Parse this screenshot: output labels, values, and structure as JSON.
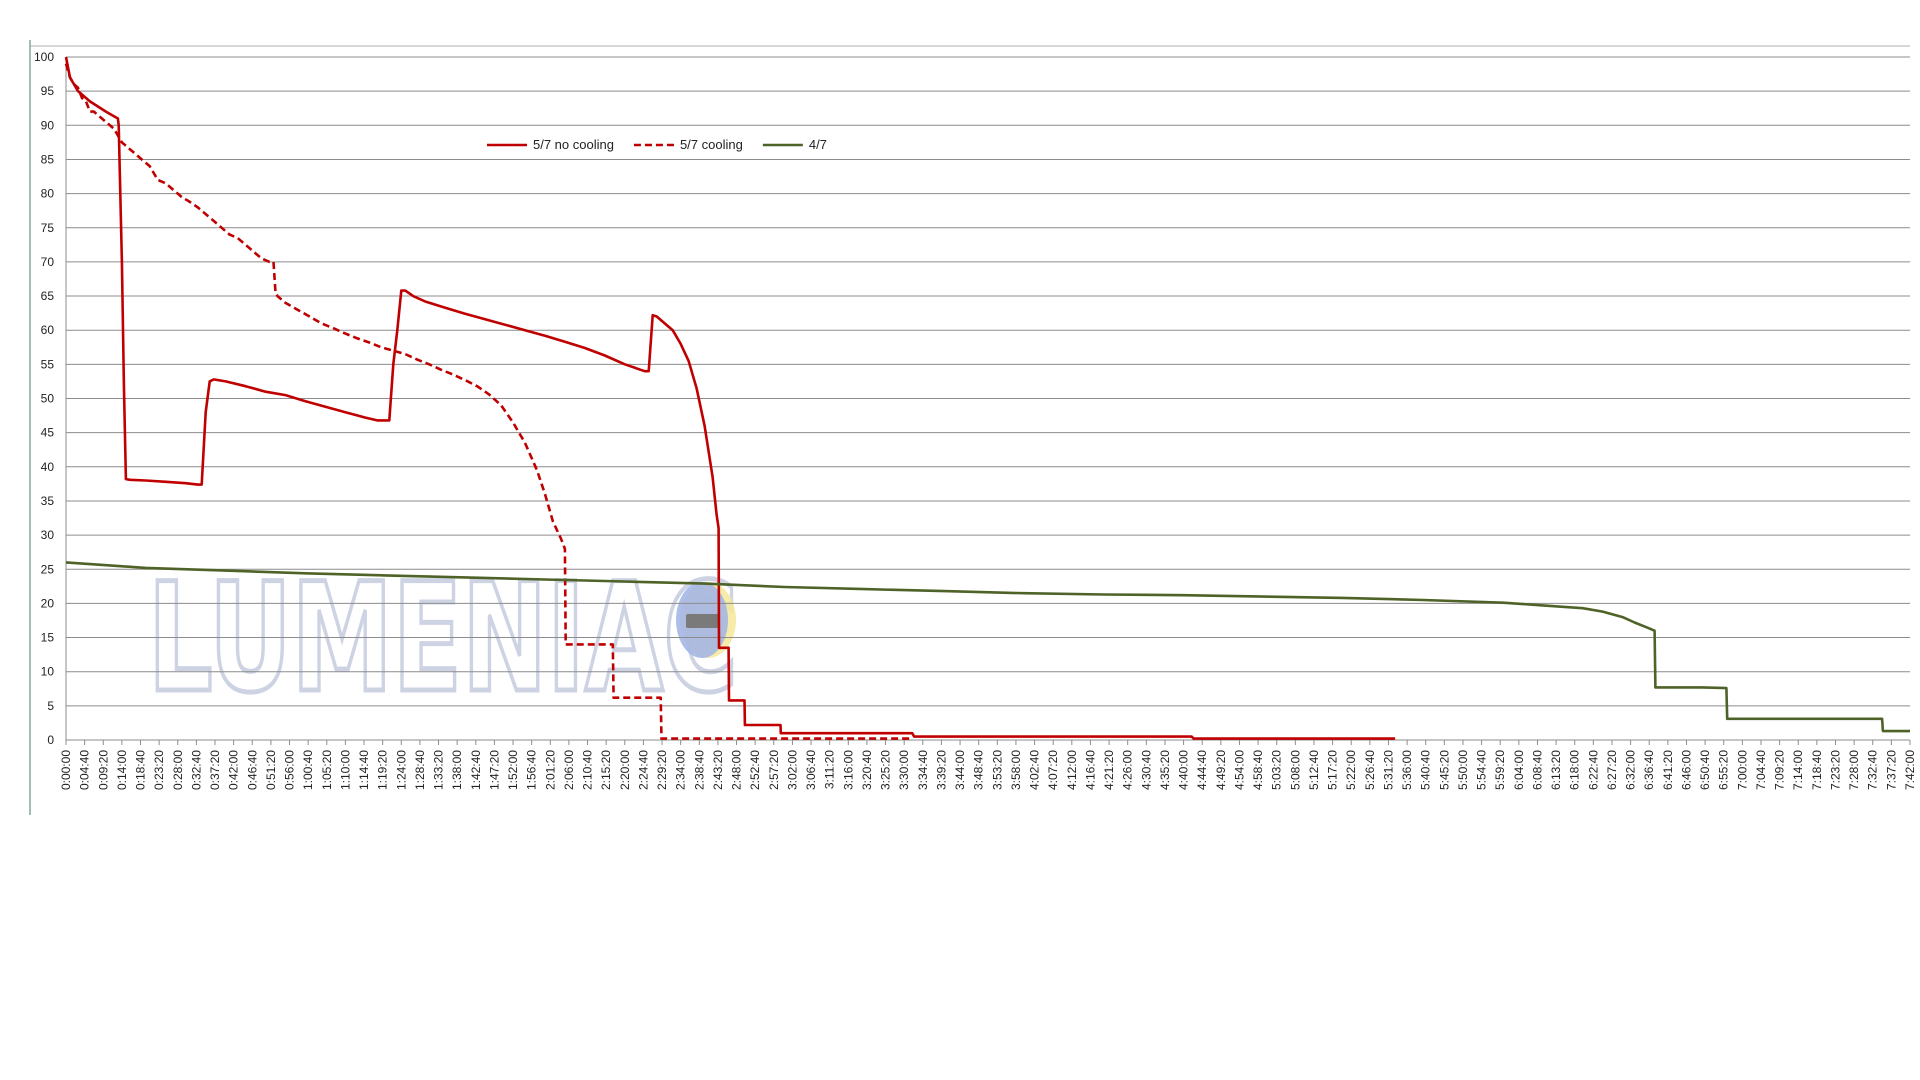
{
  "chart_data": {
    "type": "line",
    "title": "",
    "xlabel": "",
    "ylabel": "",
    "ylim": [
      0,
      100
    ],
    "yticks": [
      0,
      5,
      10,
      15,
      20,
      25,
      30,
      35,
      40,
      45,
      50,
      55,
      60,
      65,
      70,
      75,
      80,
      85,
      90,
      95,
      100
    ],
    "xlim_minutes": [
      0,
      462
    ],
    "grid": "horizontal",
    "legend_position": "top-center",
    "watermark": "LUMENIAC",
    "x_tick_labels": [
      "0:00:00",
      "0:04:40",
      "0:09:20",
      "0:14:00",
      "0:18:40",
      "0:23:20",
      "0:28:00",
      "0:32:40",
      "0:37:20",
      "0:42:00",
      "0:46:40",
      "0:51:20",
      "0:56:00",
      "1:00:40",
      "1:05:20",
      "1:10:00",
      "1:14:40",
      "1:19:20",
      "1:24:00",
      "1:28:40",
      "1:33:20",
      "1:38:00",
      "1:42:40",
      "1:47:20",
      "1:52:00",
      "1:56:40",
      "2:01:20",
      "2:06:00",
      "2:10:40",
      "2:15:20",
      "2:20:00",
      "2:24:40",
      "2:29:20",
      "2:34:00",
      "2:38:40",
      "2:43:20",
      "2:48:00",
      "2:52:40",
      "2:57:20",
      "3:02:00",
      "3:06:40",
      "3:11:20",
      "3:16:00",
      "3:20:40",
      "3:25:20",
      "3:30:00",
      "3:34:40",
      "3:39:20",
      "3:44:00",
      "3:48:40",
      "3:53:20",
      "3:58:00",
      "4:02:40",
      "4:07:20",
      "4:12:00",
      "4:16:40",
      "4:21:20",
      "4:26:00",
      "4:30:40",
      "4:35:20",
      "4:40:00",
      "4:44:40",
      "4:49:20",
      "4:54:00",
      "4:58:40",
      "5:03:20",
      "5:08:00",
      "5:12:40",
      "5:17:20",
      "5:22:00",
      "5:26:40",
      "5:31:20",
      "5:36:00",
      "5:40:40",
      "5:45:20",
      "5:50:00",
      "5:54:40",
      "5:59:20",
      "6:04:00",
      "6:08:40",
      "6:13:20",
      "6:18:00",
      "6:22:40",
      "6:27:20",
      "6:32:00",
      "6:36:40",
      "6:41:20",
      "6:46:00",
      "6:50:40",
      "6:55:20",
      "7:00:00",
      "7:04:40",
      "7:09:20",
      "7:14:00",
      "7:18:40",
      "7:23:20",
      "7:28:00",
      "7:32:40",
      "7:37:20",
      "7:42:00"
    ],
    "series": [
      {
        "name": "5/7 no cooling",
        "color": "#c00000",
        "dash": "solid",
        "points": [
          [
            0,
            100
          ],
          [
            1,
            97
          ],
          [
            3,
            95
          ],
          [
            6,
            93.5
          ],
          [
            10,
            92
          ],
          [
            13,
            91
          ],
          [
            13.2,
            90
          ],
          [
            14,
            70
          ],
          [
            14.5,
            52
          ],
          [
            15,
            38.2
          ],
          [
            16,
            38.1
          ],
          [
            20,
            38
          ],
          [
            25,
            37.8
          ],
          [
            30,
            37.6
          ],
          [
            33,
            37.4
          ],
          [
            34,
            37.4
          ],
          [
            35,
            48
          ],
          [
            36,
            52.5
          ],
          [
            37,
            52.8
          ],
          [
            40,
            52.5
          ],
          [
            45,
            51.8
          ],
          [
            50,
            51
          ],
          [
            55,
            50.5
          ],
          [
            60,
            49.6
          ],
          [
            65,
            48.8
          ],
          [
            70,
            48
          ],
          [
            75,
            47.2
          ],
          [
            78,
            46.8
          ],
          [
            81,
            46.8
          ],
          [
            82,
            55
          ],
          [
            83,
            60
          ],
          [
            84,
            65.8
          ],
          [
            85,
            65.8
          ],
          [
            87,
            65
          ],
          [
            90,
            64.2
          ],
          [
            95,
            63.3
          ],
          [
            100,
            62.4
          ],
          [
            105,
            61.6
          ],
          [
            110,
            60.8
          ],
          [
            115,
            60
          ],
          [
            120,
            59.2
          ],
          [
            125,
            58.3
          ],
          [
            130,
            57.4
          ],
          [
            135,
            56.3
          ],
          [
            140,
            55
          ],
          [
            145,
            54
          ],
          [
            146,
            54
          ],
          [
            147,
            62.2
          ],
          [
            148,
            62
          ],
          [
            150,
            61
          ],
          [
            152,
            60
          ],
          [
            154,
            58
          ],
          [
            156,
            55.5
          ],
          [
            158,
            51.5
          ],
          [
            160,
            46
          ],
          [
            162,
            38.5
          ],
          [
            163,
            33
          ],
          [
            163.5,
            31
          ],
          [
            163.6,
            13.5
          ],
          [
            165,
            13.5
          ],
          [
            166,
            13.5
          ],
          [
            166.1,
            5.8
          ],
          [
            168,
            5.8
          ],
          [
            170,
            5.8
          ],
          [
            170.1,
            2.2
          ],
          [
            175,
            2.2
          ],
          [
            179,
            2.2
          ],
          [
            179.1,
            1
          ],
          [
            185,
            1
          ],
          [
            195,
            1
          ],
          [
            205,
            1
          ],
          [
            212,
            1
          ],
          [
            212.5,
            0.5
          ],
          [
            240,
            0.5
          ],
          [
            265,
            0.5
          ],
          [
            282,
            0.5
          ],
          [
            282.5,
            0.2
          ],
          [
            300,
            0.2
          ],
          [
            320,
            0.2
          ],
          [
            333,
            0.2
          ]
        ]
      },
      {
        "name": "5/7 cooling",
        "color": "#c00000",
        "dash": "dashed",
        "points": [
          [
            0,
            99
          ],
          [
            1,
            97
          ],
          [
            2,
            96
          ],
          [
            3,
            95.5
          ],
          [
            4,
            94
          ],
          [
            5,
            93.5
          ],
          [
            6,
            92
          ],
          [
            7,
            92
          ],
          [
            8,
            91.5
          ],
          [
            9,
            91
          ],
          [
            10,
            90.5
          ],
          [
            11,
            90
          ],
          [
            12,
            89.5
          ],
          [
            13,
            88.5
          ],
          [
            14,
            87.5
          ],
          [
            15,
            87
          ],
          [
            16,
            86.5
          ],
          [
            17,
            86
          ],
          [
            18,
            85.5
          ],
          [
            19,
            85
          ],
          [
            20,
            84.5
          ],
          [
            21,
            84
          ],
          [
            22,
            83
          ],
          [
            23,
            82
          ],
          [
            25,
            81.5
          ],
          [
            27,
            80.5
          ],
          [
            29,
            79.5
          ],
          [
            31,
            78.8
          ],
          [
            33,
            78
          ],
          [
            35,
            77
          ],
          [
            37,
            76
          ],
          [
            39,
            75
          ],
          [
            41,
            74
          ],
          [
            43,
            73.5
          ],
          [
            45,
            72.5
          ],
          [
            47,
            71.5
          ],
          [
            49,
            70.5
          ],
          [
            51,
            70
          ],
          [
            52,
            70
          ],
          [
            52.5,
            65.5
          ],
          [
            53,
            65
          ],
          [
            55,
            64
          ],
          [
            58,
            63
          ],
          [
            61,
            62
          ],
          [
            64,
            61
          ],
          [
            67,
            60.3
          ],
          [
            70,
            59.5
          ],
          [
            73,
            58.8
          ],
          [
            76,
            58.2
          ],
          [
            79,
            57.5
          ],
          [
            82,
            57
          ],
          [
            85,
            56.5
          ],
          [
            88,
            55.7
          ],
          [
            91,
            55
          ],
          [
            94,
            54.2
          ],
          [
            97,
            53.5
          ],
          [
            100,
            52.7
          ],
          [
            103,
            51.8
          ],
          [
            106,
            50.6
          ],
          [
            109,
            49
          ],
          [
            112,
            46.5
          ],
          [
            115,
            43.5
          ],
          [
            118,
            39.5
          ],
          [
            120,
            36
          ],
          [
            122,
            32
          ],
          [
            124,
            29.5
          ],
          [
            125,
            28
          ],
          [
            125.2,
            14
          ],
          [
            128,
            14
          ],
          [
            134,
            14
          ],
          [
            137,
            14
          ],
          [
            137.2,
            6.2
          ],
          [
            142,
            6.2
          ],
          [
            149,
            6.2
          ],
          [
            149.2,
            0.2
          ],
          [
            160,
            0.2
          ],
          [
            180,
            0.2
          ],
          [
            200,
            0.2
          ],
          [
            212,
            0.2
          ]
        ]
      },
      {
        "name": "4/7",
        "color": "#4f6228",
        "dash": "solid",
        "points": [
          [
            0,
            26
          ],
          [
            20,
            25.2
          ],
          [
            40,
            24.8
          ],
          [
            60,
            24.4
          ],
          [
            80,
            24.1
          ],
          [
            100,
            23.8
          ],
          [
            120,
            23.5
          ],
          [
            140,
            23.2
          ],
          [
            160,
            22.9
          ],
          [
            180,
            22.4
          ],
          [
            200,
            22.1
          ],
          [
            220,
            21.8
          ],
          [
            240,
            21.5
          ],
          [
            260,
            21.3
          ],
          [
            280,
            21.2
          ],
          [
            300,
            21
          ],
          [
            320,
            20.8
          ],
          [
            340,
            20.5
          ],
          [
            360,
            20.1
          ],
          [
            370,
            19.7
          ],
          [
            380,
            19.3
          ],
          [
            385,
            18.8
          ],
          [
            390,
            18
          ],
          [
            393,
            17.2
          ],
          [
            396,
            16.5
          ],
          [
            398,
            16
          ],
          [
            398.2,
            7.7
          ],
          [
            402,
            7.7
          ],
          [
            410,
            7.7
          ],
          [
            416,
            7.6
          ],
          [
            416.2,
            3.1
          ],
          [
            430,
            3.1
          ],
          [
            445,
            3.1
          ],
          [
            455,
            3.1
          ],
          [
            455.2,
            1.3
          ],
          [
            462,
            1.3
          ]
        ]
      }
    ]
  }
}
